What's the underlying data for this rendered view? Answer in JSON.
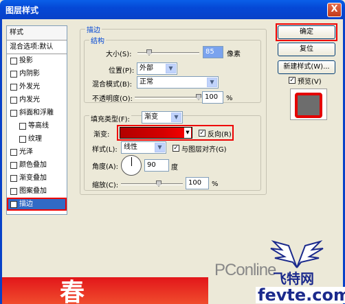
{
  "window": {
    "title": "图层样式",
    "close_label": "X"
  },
  "left_panel": {
    "header": "样式",
    "blend_options": "混合选项:默认",
    "items": [
      {
        "label": "投影",
        "checked": false,
        "sub": false
      },
      {
        "label": "内阴影",
        "checked": false,
        "sub": false
      },
      {
        "label": "外发光",
        "checked": false,
        "sub": false
      },
      {
        "label": "内发光",
        "checked": false,
        "sub": false
      },
      {
        "label": "斜面和浮雕",
        "checked": false,
        "sub": false
      },
      {
        "label": "等高线",
        "checked": false,
        "sub": true
      },
      {
        "label": "纹理",
        "checked": false,
        "sub": true
      },
      {
        "label": "光泽",
        "checked": false,
        "sub": false
      },
      {
        "label": "颜色叠加",
        "checked": false,
        "sub": false
      },
      {
        "label": "渐变叠加",
        "checked": false,
        "sub": false
      },
      {
        "label": "图案叠加",
        "checked": false,
        "sub": false
      },
      {
        "label": "描边",
        "checked": true,
        "sub": false,
        "selected": true
      }
    ]
  },
  "stroke": {
    "group_title": "描边",
    "structure_title": "结构",
    "size_label": "大小(S):",
    "size_value": "85",
    "size_unit": "像素",
    "position_label": "位置(P):",
    "position_value": "外部",
    "blend_label": "混合模式(B):",
    "blend_value": "正常",
    "opacity_label": "不透明度(O):",
    "opacity_value": "100",
    "opacity_unit": "%",
    "fill_type_label": "填充类型(F):",
    "fill_type_value": "渐变",
    "gradient_label": "渐变:",
    "reverse_label": "反向(R)",
    "reverse_checked": true,
    "style_label": "样式(L):",
    "style_value": "线性",
    "align_label": "与图层对齐(G)",
    "align_checked": true,
    "angle_label": "角度(A):",
    "angle_value": "90",
    "angle_unit": "度",
    "scale_label": "缩放(C):",
    "scale_value": "100",
    "scale_unit": "%"
  },
  "buttons": {
    "ok": "确定",
    "reset": "复位",
    "new_style": "新建样式(W)...",
    "preview_label": "预览(V)",
    "preview_checked": true
  },
  "watermark": {
    "pconline": "PConline",
    "feite": "飞特网",
    "url": "fevte.com",
    "banner_char": "春"
  },
  "colors": {
    "accent_red": "#e00000",
    "title_blue": "#0548d6",
    "group_label": "#0046d5"
  }
}
